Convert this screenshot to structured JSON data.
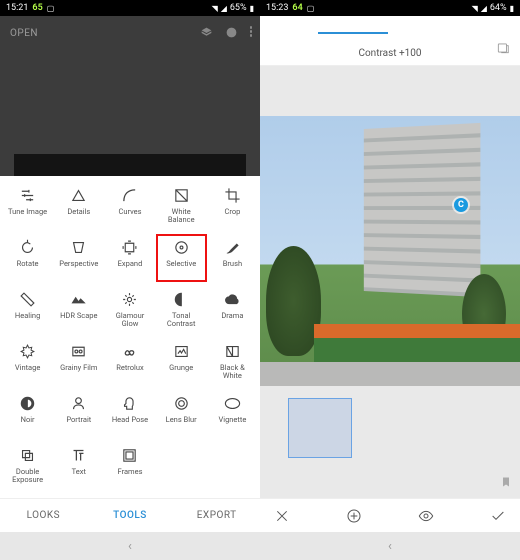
{
  "left": {
    "status": {
      "time": "15:21",
      "batt_ind": "65",
      "batt_pct": "65%"
    },
    "header": {
      "open": "OPEN"
    },
    "tools": [
      {
        "id": "tune-image",
        "label": "Tune Image",
        "icon": "sliders"
      },
      {
        "id": "details",
        "label": "Details",
        "icon": "triangle"
      },
      {
        "id": "curves",
        "label": "Curves",
        "icon": "curve"
      },
      {
        "id": "white-balance",
        "label": "White\nBalance",
        "icon": "wb"
      },
      {
        "id": "crop",
        "label": "Crop",
        "icon": "crop"
      },
      {
        "id": "rotate",
        "label": "Rotate",
        "icon": "rotate"
      },
      {
        "id": "perspective",
        "label": "Perspective",
        "icon": "persp"
      },
      {
        "id": "expand",
        "label": "Expand",
        "icon": "expand"
      },
      {
        "id": "selective",
        "label": "Selective",
        "icon": "selective",
        "highlight": true
      },
      {
        "id": "brush",
        "label": "Brush",
        "icon": "brush"
      },
      {
        "id": "healing",
        "label": "Healing",
        "icon": "heal"
      },
      {
        "id": "hdr-scape",
        "label": "HDR Scape",
        "icon": "hdr"
      },
      {
        "id": "glamour-glow",
        "label": "Glamour\nGlow",
        "icon": "glow"
      },
      {
        "id": "tonal-contrast",
        "label": "Tonal\nContrast",
        "icon": "tonal"
      },
      {
        "id": "drama",
        "label": "Drama",
        "icon": "drama"
      },
      {
        "id": "vintage",
        "label": "Vintage",
        "icon": "vintage"
      },
      {
        "id": "grainy-film",
        "label": "Grainy Film",
        "icon": "grain"
      },
      {
        "id": "retrolux",
        "label": "Retrolux",
        "icon": "retro"
      },
      {
        "id": "grunge",
        "label": "Grunge",
        "icon": "grunge"
      },
      {
        "id": "black-white",
        "label": "Black &\nWhite",
        "icon": "bw"
      },
      {
        "id": "noir",
        "label": "Noir",
        "icon": "noir"
      },
      {
        "id": "portrait",
        "label": "Portrait",
        "icon": "portrait"
      },
      {
        "id": "head-pose",
        "label": "Head Pose",
        "icon": "headpose"
      },
      {
        "id": "lens-blur",
        "label": "Lens Blur",
        "icon": "lensblur"
      },
      {
        "id": "vignette",
        "label": "Vignette",
        "icon": "vignette"
      },
      {
        "id": "double-exposure",
        "label": "Double\nExposure",
        "icon": "double"
      },
      {
        "id": "text",
        "label": "Text",
        "icon": "text"
      },
      {
        "id": "frames",
        "label": "Frames",
        "icon": "frames"
      }
    ],
    "tabs": {
      "looks": "LOOKS",
      "tools": "TOOLS",
      "export": "EXPORT",
      "active": "tools"
    }
  },
  "right": {
    "status": {
      "time": "15:23",
      "batt_ind": "64",
      "batt_pct": "64%"
    },
    "title": "Contrast +100",
    "control_point": "C"
  }
}
